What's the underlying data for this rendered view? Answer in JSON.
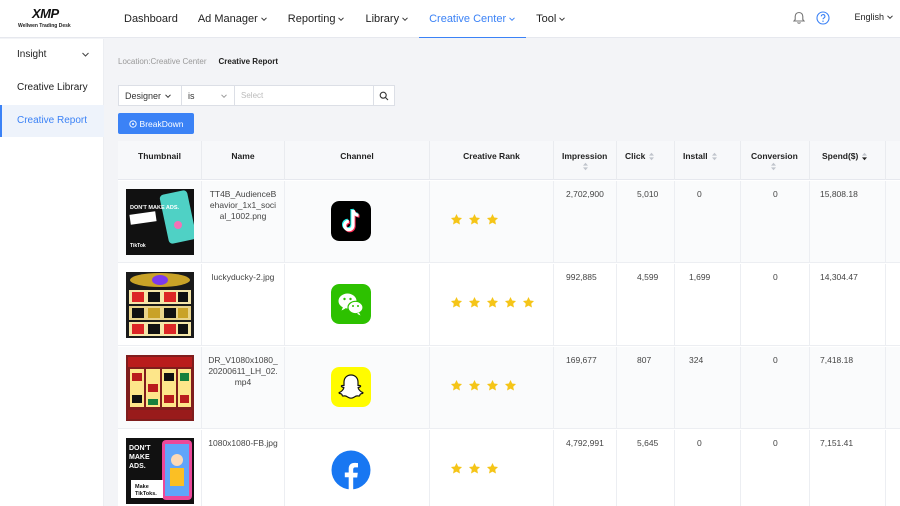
{
  "brand": {
    "logo_text": "XMP",
    "logo_sub": "Wellwen Trading Desk"
  },
  "nav": {
    "items": [
      {
        "label": "Dashboard",
        "has_menu": false
      },
      {
        "label": "Ad Manager",
        "has_menu": true
      },
      {
        "label": "Reporting",
        "has_menu": true
      },
      {
        "label": "Library",
        "has_menu": true
      },
      {
        "label": "Creative Center",
        "has_menu": true,
        "active": true
      },
      {
        "label": "Tool",
        "has_menu": true
      }
    ],
    "language": "English",
    "accent": "#3b82f6"
  },
  "sidebar": {
    "items": [
      {
        "label": "Insight",
        "has_menu": true
      },
      {
        "label": "Creative Library"
      },
      {
        "label": "Creative Report",
        "active": true
      }
    ]
  },
  "breadcrumb": {
    "location": "Location:Creative Center",
    "current": "Creative Report"
  },
  "filter": {
    "field": "Designer",
    "operator": "is",
    "placeholder": "Select"
  },
  "breakdown_label": "BreakDown",
  "table": {
    "columns": [
      "Thumbnail",
      "Name",
      "Channel",
      "Creative Rank",
      "Impression",
      "Click",
      "Install",
      "Conversion",
      "Spend($)"
    ],
    "rows": [
      {
        "name": "TT4B_AudienceBehavior_1x1_social_1002.png",
        "channel": "tiktok-icon",
        "rank": 3,
        "impression": "2,702,900",
        "click": "5,010",
        "install": "0",
        "conversion": "0",
        "spend": "15,808.18",
        "thumb_text": "DON'T MAKE ADS.",
        "thumb_caption": "TikTok"
      },
      {
        "name": "luckyducky-2.jpg",
        "channel": "wechat-icon",
        "rank": 5,
        "impression": "992,885",
        "click": "4,599",
        "install": "1,699",
        "conversion": "0",
        "spend": "14,304.47",
        "thumb_text": "",
        "thumb_caption": ""
      },
      {
        "name": "DR_V1080x1080_20200611_LH_02.mp4",
        "channel": "snapchat-icon",
        "rank": 4,
        "impression": "169,677",
        "click": "807",
        "install": "324",
        "conversion": "0",
        "spend": "7,418.18",
        "thumb_text": "",
        "thumb_caption": ""
      },
      {
        "name": "1080x1080-FB.jpg",
        "channel": "facebook-icon",
        "rank": 3,
        "impression": "4,792,991",
        "click": "5,645",
        "install": "0",
        "conversion": "0",
        "spend": "7,151.41",
        "thumb_text": "DON'T MAKE ADS.",
        "thumb_caption": "Make TikToks."
      }
    ]
  },
  "colors": {
    "star": "#f5c518",
    "tiktok": "#000000",
    "wechat": "#2dc100",
    "snapchat": "#fffc00",
    "facebook": "#1877f2"
  }
}
